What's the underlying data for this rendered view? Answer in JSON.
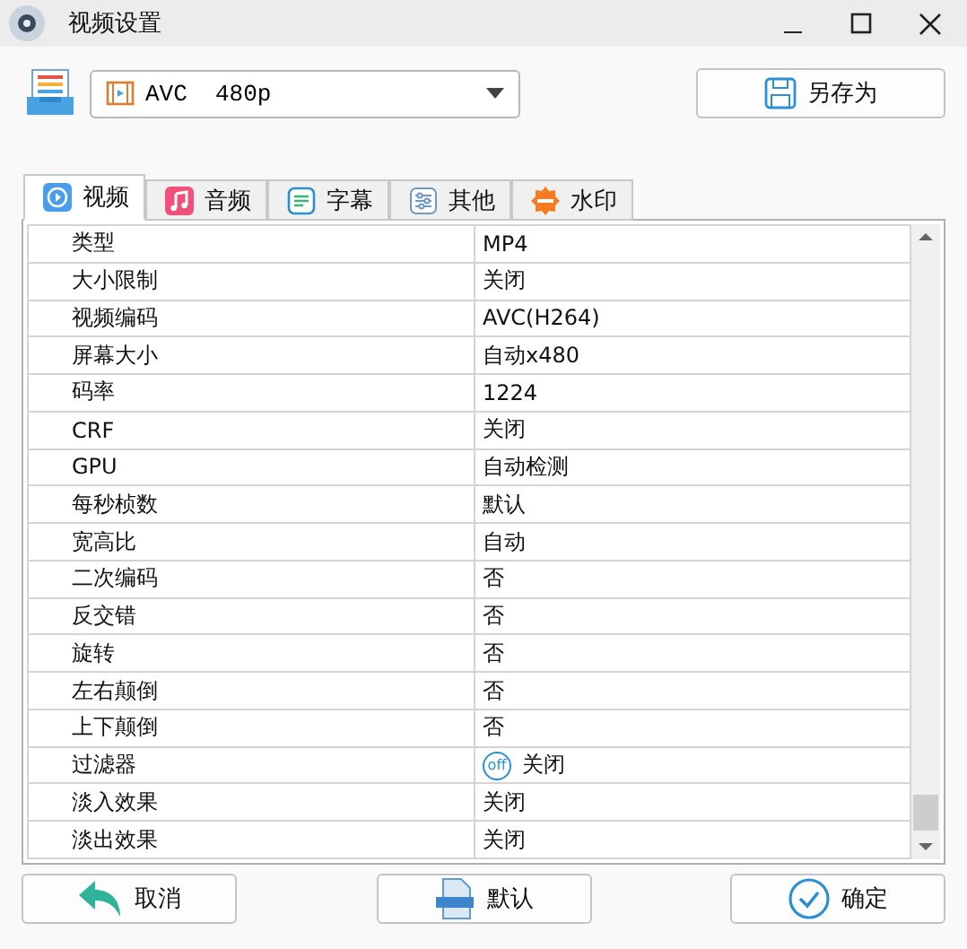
{
  "window": {
    "title": "视频设置"
  },
  "preset": {
    "value": "AVC  480p"
  },
  "save_as_button": "另存为",
  "tabs": [
    {
      "label": "视频",
      "kind": "video",
      "selected": true
    },
    {
      "label": "音频",
      "kind": "music",
      "selected": false
    },
    {
      "label": "字幕",
      "kind": "subtitle",
      "selected": false
    },
    {
      "label": "其他",
      "kind": "sliders",
      "selected": false
    },
    {
      "label": "水印",
      "kind": "badge",
      "selected": false
    }
  ],
  "rows": [
    {
      "name": "类型",
      "value": "MP4"
    },
    {
      "name": "大小限制",
      "value": "关闭"
    },
    {
      "name": "视频编码",
      "value": "AVC(H264)"
    },
    {
      "name": "屏幕大小",
      "value": "自动x480"
    },
    {
      "name": "码率",
      "value": "1224"
    },
    {
      "name": "CRF",
      "value": "关闭"
    },
    {
      "name": "GPU",
      "value": "自动检测"
    },
    {
      "name": "每秒桢数",
      "value": "默认"
    },
    {
      "name": "宽高比",
      "value": "自动"
    },
    {
      "name": "二次编码",
      "value": "否"
    },
    {
      "name": "反交错",
      "value": "否"
    },
    {
      "name": "旋转",
      "value": "否"
    },
    {
      "name": "左右颠倒",
      "value": "否"
    },
    {
      "name": "上下颠倒",
      "value": "否"
    },
    {
      "name": "过滤器",
      "value": "关闭",
      "badge": "off"
    },
    {
      "name": "淡入效果",
      "value": "关闭"
    },
    {
      "name": "淡出效果",
      "value": "关闭"
    }
  ],
  "buttons": [
    {
      "label": "取消",
      "kind": "cancel"
    },
    {
      "label": "默认",
      "kind": "default"
    },
    {
      "label": "确定",
      "kind": "ok"
    }
  ]
}
